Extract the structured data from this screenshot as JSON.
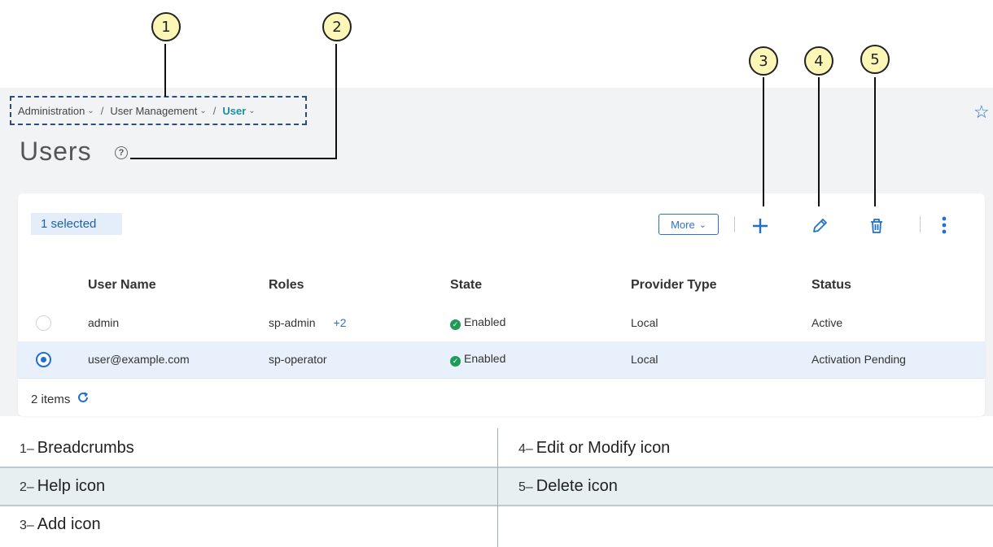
{
  "callouts": [
    "1",
    "2",
    "3",
    "4",
    "5"
  ],
  "breadcrumb": {
    "items": [
      "Administration",
      "User Management",
      "User"
    ],
    "separator": "/"
  },
  "page": {
    "title": "Users",
    "help_icon": "question-circle-icon",
    "favorite_icon": "star-outline-icon"
  },
  "toolbar": {
    "selection": "1 selected",
    "more_label": "More",
    "icons": [
      "add-icon",
      "edit-pencil-icon",
      "delete-trash-icon",
      "vertical-ellipsis-icon"
    ]
  },
  "table": {
    "columns": [
      "User Name",
      "Roles",
      "State",
      "Provider Type",
      "Status"
    ],
    "rows": [
      {
        "selected": false,
        "user": "admin",
        "role": "sp-admin",
        "role_extra": "+2",
        "state": "Enabled",
        "provider": "Local",
        "status": "Active"
      },
      {
        "selected": true,
        "user": "user@example.com",
        "role": "sp-operator",
        "role_extra": "",
        "state": "Enabled",
        "provider": "Local",
        "status": "Activation Pending"
      }
    ]
  },
  "footer": {
    "count": "2 items",
    "refresh_icon": "refresh-icon"
  },
  "legend": [
    {
      "num": "1–",
      "text": "Breadcrumbs"
    },
    {
      "num": "2–",
      "text": "Help icon"
    },
    {
      "num": "3–",
      "text": "Add icon"
    },
    {
      "num": "4–",
      "text": "Edit or Modify icon"
    },
    {
      "num": "5–",
      "text": "Delete icon"
    }
  ],
  "colors": {
    "accent": "#1f6fd1",
    "current_crumb": "#1a8fa0",
    "enabled": "#1f9a57",
    "callout_fill": "#fcf7b7",
    "selected_row": "#e8f0fb",
    "legend_shade": "#e7eff0"
  }
}
